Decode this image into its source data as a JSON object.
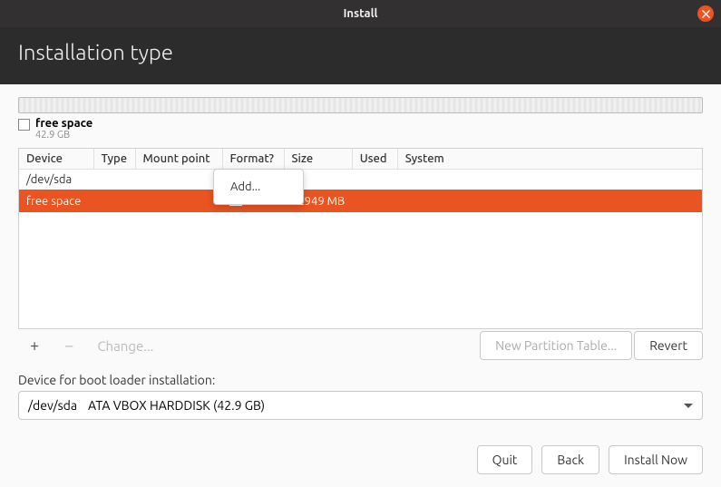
{
  "window": {
    "title": "Install"
  },
  "page": {
    "heading": "Installation type"
  },
  "legend": {
    "label": "free space",
    "size": "42.9 GB"
  },
  "table": {
    "headers": {
      "device": "Device",
      "type": "Type",
      "mount": "Mount point",
      "format": "Format?",
      "size": "Size",
      "used": "Used",
      "system": "System"
    },
    "rows": [
      {
        "device": "/dev/sda",
        "type": "",
        "mount": "",
        "format": "",
        "size": "",
        "used": "",
        "system": "",
        "selected": false,
        "kind": "disk"
      },
      {
        "device": " free space",
        "type": "",
        "mount": "",
        "format": "checkbox",
        "size": "42949 MB",
        "used": "",
        "system": "",
        "selected": true,
        "kind": "free"
      }
    ]
  },
  "context_menu": {
    "add": "Add..."
  },
  "toolbar": {
    "plus": "+",
    "minus": "−",
    "change": "Change...",
    "new_table": "New Partition Table...",
    "revert": "Revert"
  },
  "bootloader": {
    "label": "Device for boot loader installation:",
    "device": "/dev/sda",
    "desc": "ATA VBOX HARDDISK (42.9 GB)"
  },
  "footer": {
    "quit": "Quit",
    "back": "Back",
    "install": "Install Now"
  }
}
